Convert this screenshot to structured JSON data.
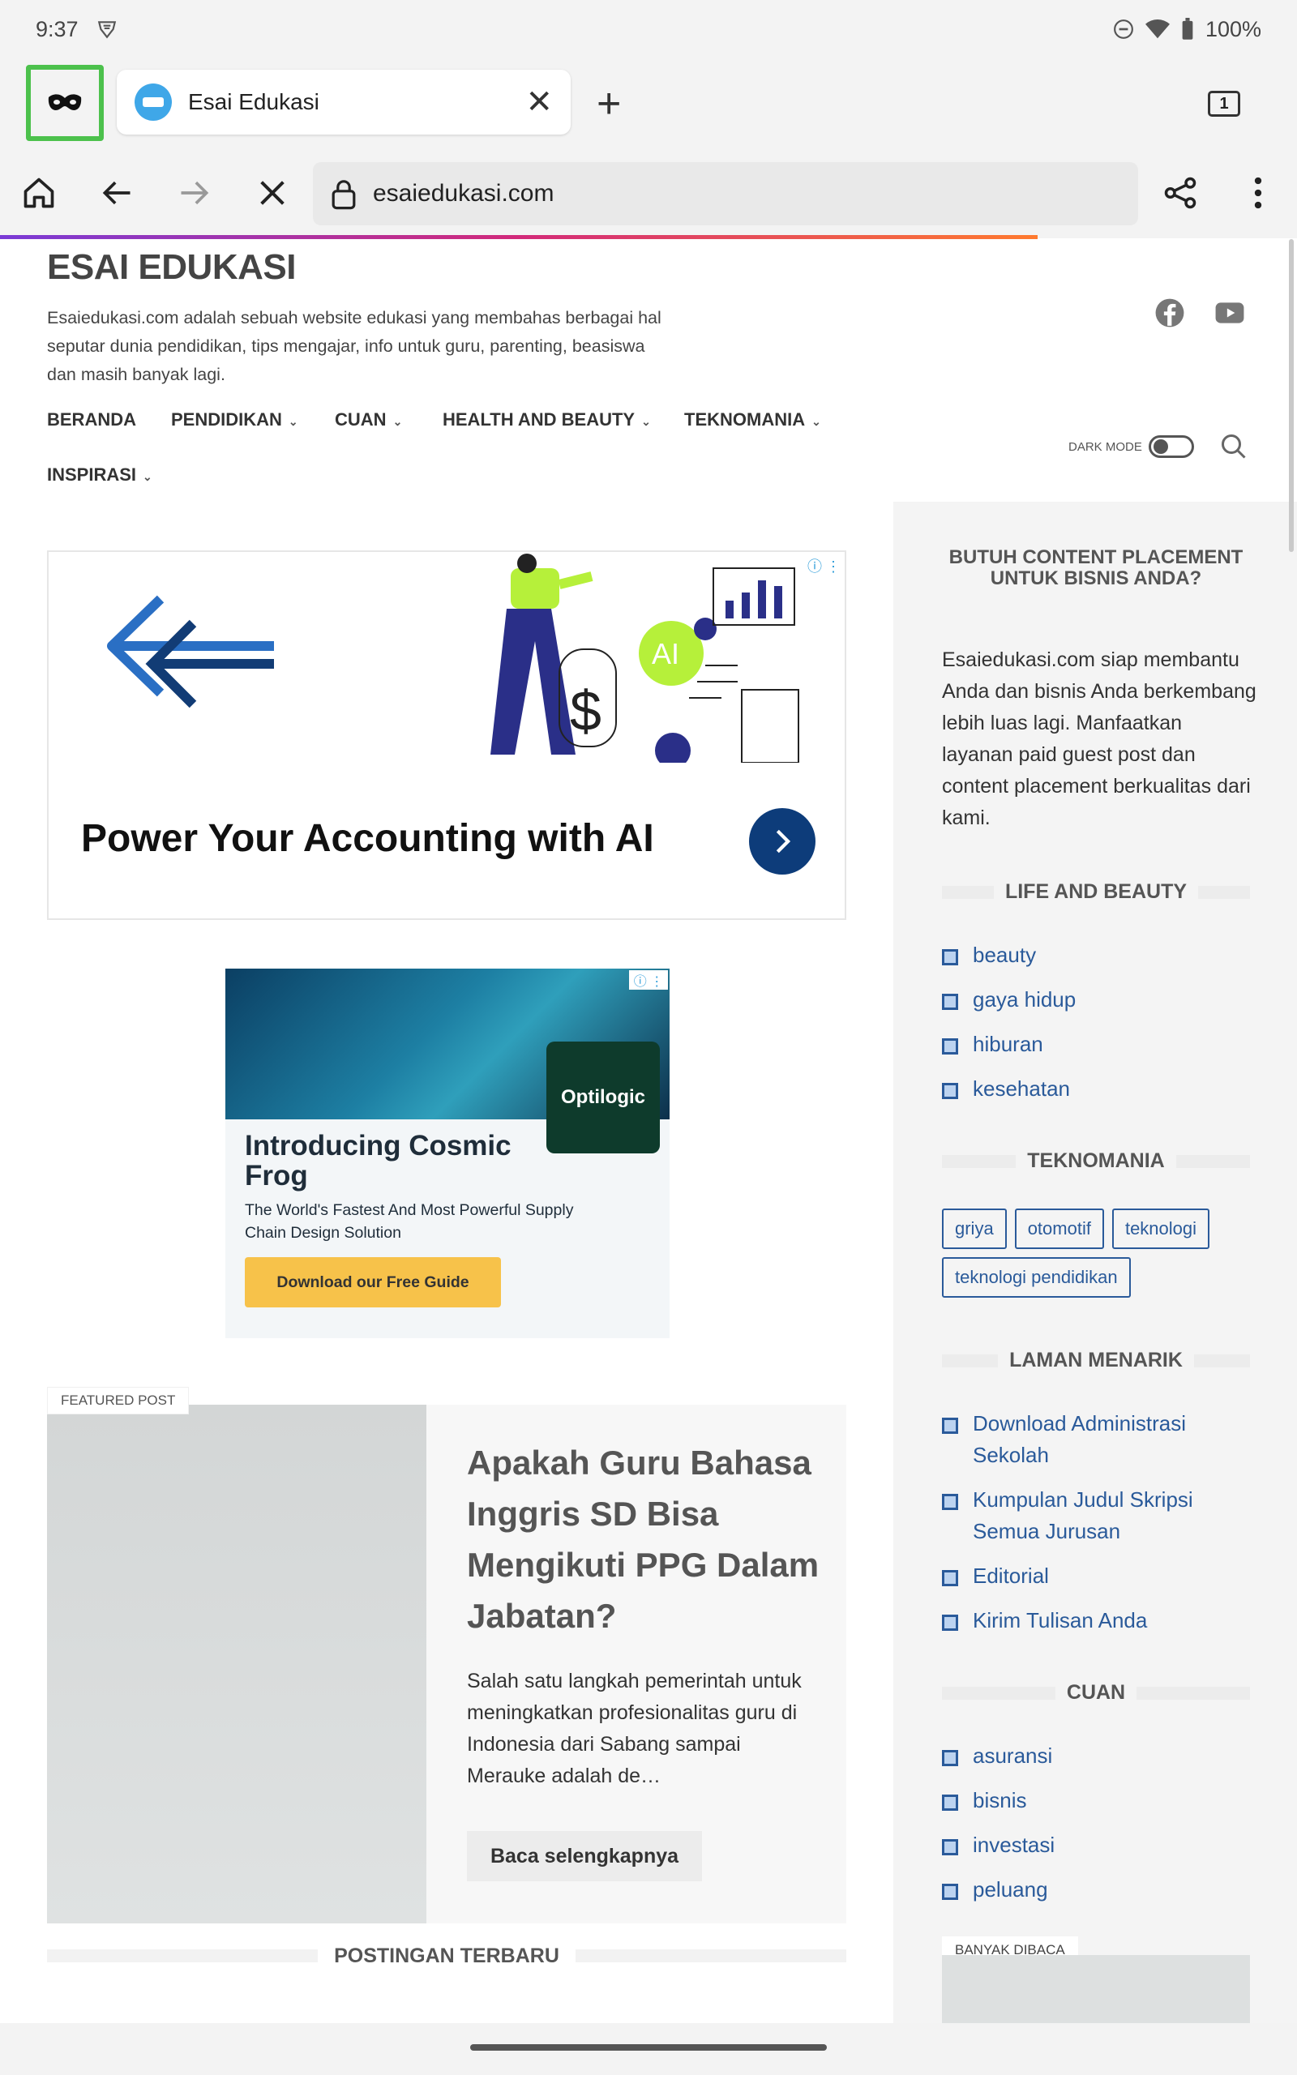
{
  "status_bar": {
    "time": "9:37",
    "battery": "100%"
  },
  "browser": {
    "tab_title": "Esai Edukasi",
    "tab_count": "1",
    "url": "esaiedukasi.com"
  },
  "site": {
    "title": "ESAI EDUKASI",
    "description": "Esaiedukasi.com adalah sebuah website edukasi yang membahas berbagai hal seputar dunia pendidikan, tips mengajar, info untuk guru, parenting, beasiswa dan masih banyak lagi.",
    "nav": [
      {
        "label": "BERANDA"
      },
      {
        "label": "PENDIDIKAN"
      },
      {
        "label": "CUAN"
      },
      {
        "label": "HEALTH AND BEAUTY"
      },
      {
        "label": "TEKNOMANIA"
      },
      {
        "label": "INSPIRASI"
      }
    ],
    "dark_mode_label": "DARK MODE"
  },
  "ads": {
    "ad1_headline": "Power Your Accounting with AI",
    "ad1_ai_badge": "AI",
    "ad2_brand": "Optilogic",
    "ad2_intro": "Introducing Cosmic Frog",
    "ad2_sub": "The World's Fastest And Most Powerful Supply Chain Design Solution",
    "ad2_cta": "Download our Free Guide"
  },
  "featured": {
    "label": "FEATURED POST",
    "title": "Apakah Guru Bahasa Inggris SD Bisa Mengikuti PPG Dalam Jabatan?",
    "excerpt": "Salah satu langkah pemerintah untuk meningkatkan profesionalitas guru di Indonesia dari Sabang sampai Merauke adalah de…",
    "read_more": "Baca selengkapnya"
  },
  "latest_title": "POSTINGAN TERBARU",
  "sidebar": {
    "promo_title": "BUTUH CONTENT PLACEMENT UNTUK BISNIS ANDA?",
    "promo_text": "Esaiedukasi.com siap membantu Anda dan bisnis Anda berkembang lebih luas lagi. Manfaatkan layanan paid guest post dan content placement berkualitas dari kami.",
    "life_title": "LIFE AND BEAUTY",
    "life_links": [
      "beauty",
      "gaya hidup",
      "hiburan",
      "kesehatan"
    ],
    "tekno_title": "TEKNOMANIA",
    "tekno_tags": [
      "griya",
      "otomotif",
      "teknologi",
      "teknologi pendidikan"
    ],
    "laman_title": "LAMAN MENARIK",
    "laman_links": [
      "Download Administrasi Sekolah",
      "Kumpulan Judul Skripsi Semua Jurusan",
      "Editorial",
      "Kirim Tulisan Anda"
    ],
    "cuan_title": "CUAN",
    "cuan_links": [
      "asuransi",
      "bisnis",
      "investasi",
      "peluang"
    ],
    "banyak_label": "BANYAK DIBACA"
  },
  "colors": {
    "accent_link": "#2a5a9a",
    "private_highlight": "#4cc14c"
  }
}
